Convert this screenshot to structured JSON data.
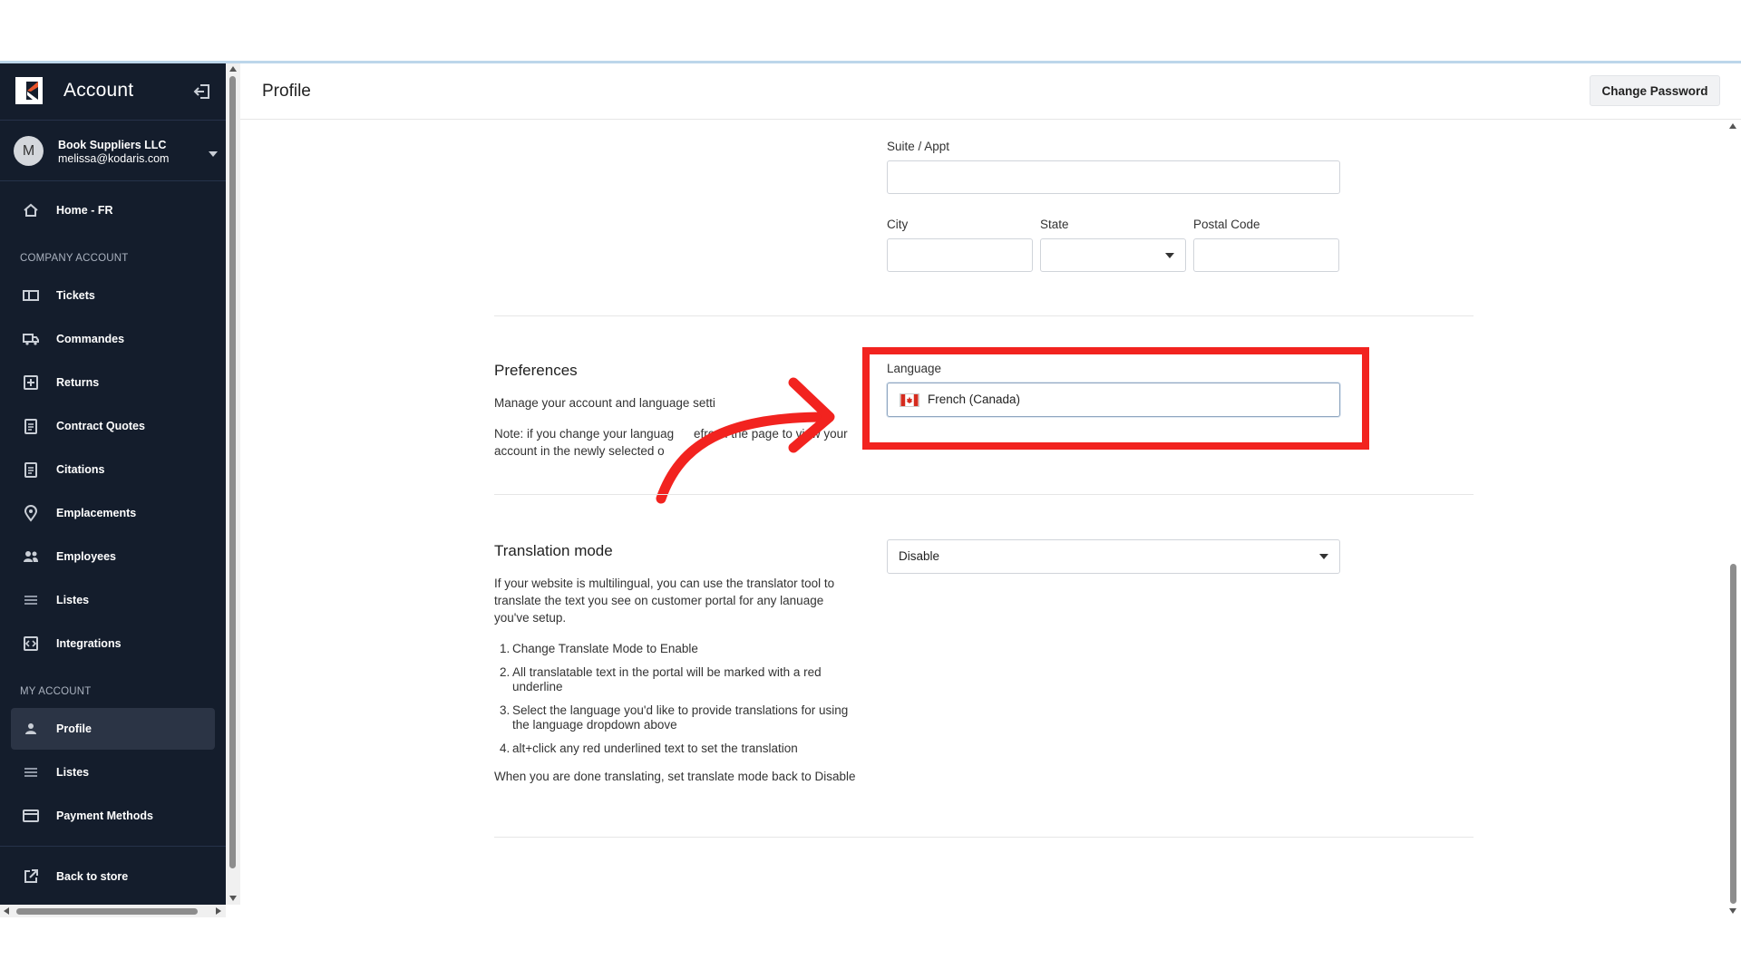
{
  "sidebar": {
    "title": "Account",
    "account": {
      "avatar_initial": "M",
      "name": "Book Suppliers LLC",
      "email": "melissa@kodaris.com"
    },
    "home": "Home - FR",
    "section_company": "COMPANY ACCOUNT",
    "company_items": [
      "Tickets",
      "Commandes",
      "Returns",
      "Contract Quotes",
      "Citations",
      "Emplacements",
      "Employees",
      "Listes",
      "Integrations"
    ],
    "section_my": "MY ACCOUNT",
    "my_items": [
      "Profile",
      "Listes",
      "Payment Methods"
    ],
    "back": "Back to store"
  },
  "header": {
    "title": "Profile",
    "change_password": "Change Password"
  },
  "address": {
    "suite_label": "Suite / Appt",
    "city_label": "City",
    "state_label": "State",
    "postal_label": "Postal Code"
  },
  "preferences": {
    "title": "Preferences",
    "desc": "Manage your account and language setti",
    "note_line1": "Note: if you change your languag",
    "note_line1b": "efresh the page to view your",
    "note_line2": "account in the newly selected o",
    "language_label": "Language",
    "language_value": "French (Canada)"
  },
  "translation": {
    "title": "Translation mode",
    "value": "Disable",
    "intro": "If your website is multilingual, you can use the translator tool to translate the text you see on customer portal for any lanuage you've setup.",
    "steps": [
      "Change Translate Mode to Enable",
      "All translatable text in the portal will be marked with a red underline",
      "Select the language you'd like to provide translations for using the language dropdown above",
      "alt+click any red underlined text to set the translation"
    ],
    "outro": "When you are done translating, set translate mode back to Disable"
  },
  "colors": {
    "sidebar_bg": "#141d2c",
    "highlight": "#f2231f",
    "arrow": "#f2231f"
  }
}
